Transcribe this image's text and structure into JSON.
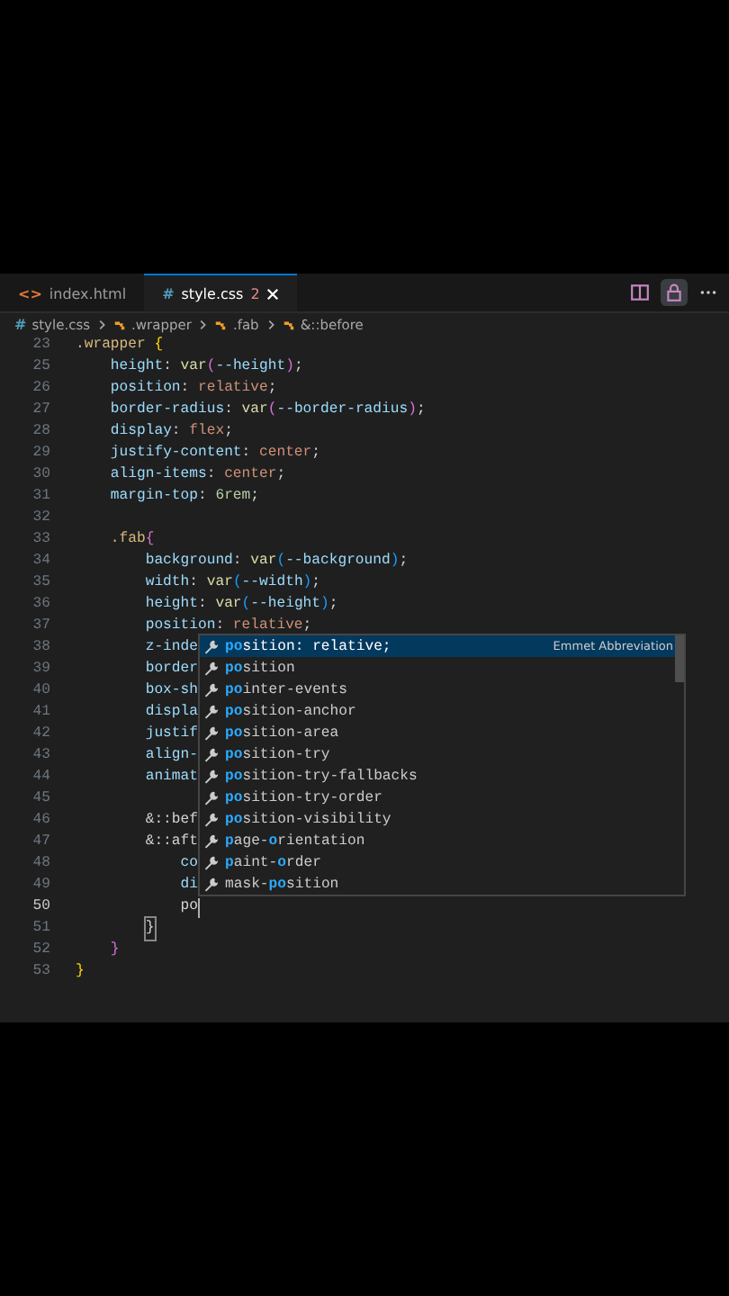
{
  "tabs": [
    {
      "label": "index.html",
      "icon": "<>",
      "kind": "html",
      "selected": false
    },
    {
      "label": "style.css",
      "icon": "#",
      "badge": "2",
      "kind": "css",
      "selected": true
    }
  ],
  "breadcrumb": [
    {
      "text": "style.css",
      "icon": "#",
      "kind": "file"
    },
    {
      "text": ".wrapper",
      "kind": "symbol"
    },
    {
      "text": ".fab",
      "kind": "symbol"
    },
    {
      "text": "&::before",
      "kind": "symbol"
    }
  ],
  "code_lines": [
    {
      "number": "23",
      "active": false,
      "segments": [
        {
          "text": ".wrapper ",
          "kind": "selector"
        },
        {
          "text": "{",
          "kind": "bracket1"
        }
      ],
      "children": [
        {
          "number": "25",
          "active": false,
          "segments": [
            {
              "text": "height",
              "kind": "property"
            },
            {
              "text": ": ",
              "kind": "plain"
            },
            {
              "text": "var",
              "kind": "function"
            },
            {
              "text": "(",
              "kind": "bracket2"
            },
            {
              "text": "--height",
              "kind": "property"
            },
            {
              "text": ")",
              "kind": "bracket2"
            },
            {
              "text": ";",
              "kind": "plain"
            }
          ]
        },
        {
          "number": "26",
          "active": false,
          "segments": [
            {
              "text": "position",
              "kind": "property"
            },
            {
              "text": ": ",
              "kind": "plain"
            },
            {
              "text": "relative",
              "kind": "value"
            },
            {
              "text": ";",
              "kind": "plain"
            }
          ]
        },
        {
          "number": "27",
          "active": false,
          "segments": [
            {
              "text": "border-radius",
              "kind": "property"
            },
            {
              "text": ": ",
              "kind": "plain"
            },
            {
              "text": "var",
              "kind": "function"
            },
            {
              "text": "(",
              "kind": "bracket2"
            },
            {
              "text": "--border-radius",
              "kind": "property"
            },
            {
              "text": ")",
              "kind": "bracket2"
            },
            {
              "text": ";",
              "kind": "plain"
            }
          ]
        },
        {
          "number": "28",
          "active": false,
          "segments": [
            {
              "text": "display",
              "kind": "property"
            },
            {
              "text": ": ",
              "kind": "plain"
            },
            {
              "text": "flex",
              "kind": "value"
            },
            {
              "text": ";",
              "kind": "plain"
            }
          ]
        },
        {
          "number": "29",
          "active": false,
          "segments": [
            {
              "text": "justify-content",
              "kind": "property"
            },
            {
              "text": ": ",
              "kind": "plain"
            },
            {
              "text": "center",
              "kind": "value"
            },
            {
              "text": ";",
              "kind": "plain"
            }
          ]
        },
        {
          "number": "30",
          "active": false,
          "segments": [
            {
              "text": "align-items",
              "kind": "property"
            },
            {
              "text": ": ",
              "kind": "plain"
            },
            {
              "text": "center",
              "kind": "value"
            },
            {
              "text": ";",
              "kind": "plain"
            }
          ]
        },
        {
          "number": "31",
          "active": false,
          "segments": [
            {
              "text": "margin-top",
              "kind": "property"
            },
            {
              "text": ": ",
              "kind": "plain"
            },
            {
              "text": "6rem",
              "kind": "number"
            },
            {
              "text": ";",
              "kind": "plain"
            }
          ]
        },
        {
          "number": "32",
          "active": false
        },
        {
          "number": "33",
          "active": false,
          "segments": [
            {
              "text": ".fab",
              "kind": "selector"
            },
            {
              "text": "{",
              "kind": "bracket2"
            }
          ],
          "children": [
            {
              "number": "34",
              "active": false,
              "segments": [
                {
                  "text": "background",
                  "kind": "property"
                },
                {
                  "text": ": ",
                  "kind": "plain"
                },
                {
                  "text": "var",
                  "kind": "function"
                },
                {
                  "text": "(",
                  "kind": "bracket3"
                },
                {
                  "text": "--background",
                  "kind": "property"
                },
                {
                  "text": ")",
                  "kind": "bracket3"
                },
                {
                  "text": ";",
                  "kind": "plain"
                }
              ]
            },
            {
              "number": "35",
              "active": false,
              "segments": [
                {
                  "text": "width",
                  "kind": "property"
                },
                {
                  "text": ": ",
                  "kind": "plain"
                },
                {
                  "text": "var",
                  "kind": "function"
                },
                {
                  "text": "(",
                  "kind": "bracket3"
                },
                {
                  "text": "--width",
                  "kind": "property"
                },
                {
                  "text": ")",
                  "kind": "bracket3"
                },
                {
                  "text": ";",
                  "kind": "plain"
                }
              ]
            },
            {
              "number": "36",
              "active": false,
              "segments": [
                {
                  "text": "height",
                  "kind": "property"
                },
                {
                  "text": ": ",
                  "kind": "plain"
                },
                {
                  "text": "var",
                  "kind": "function"
                },
                {
                  "text": "(",
                  "kind": "bracket3"
                },
                {
                  "text": "--height",
                  "kind": "property"
                },
                {
                  "text": ")",
                  "kind": "bracket3"
                },
                {
                  "text": ";",
                  "kind": "plain"
                }
              ]
            },
            {
              "number": "37",
              "active": false,
              "segments": [
                {
                  "text": "position",
                  "kind": "property"
                },
                {
                  "text": ": ",
                  "kind": "plain"
                },
                {
                  "text": "relative",
                  "kind": "value"
                },
                {
                  "text": ";",
                  "kind": "plain"
                }
              ]
            },
            {
              "number": "38",
              "active": false,
              "segments": [
                {
                  "text": "z-inde",
                  "kind": "property"
                }
              ]
            },
            {
              "number": "39",
              "active": false,
              "segments": [
                {
                  "text": "border",
                  "kind": "property"
                }
              ]
            },
            {
              "number": "40",
              "active": false,
              "segments": [
                {
                  "text": "box-sh",
                  "kind": "property"
                }
              ]
            },
            {
              "number": "41",
              "active": false,
              "segments": [
                {
                  "text": "displa",
                  "kind": "property"
                }
              ]
            },
            {
              "number": "42",
              "active": false,
              "segments": [
                {
                  "text": "justif",
                  "kind": "property"
                }
              ]
            },
            {
              "number": "43",
              "active": false,
              "segments": [
                {
                  "text": "align-",
                  "kind": "property"
                }
              ]
            },
            {
              "number": "44",
              "active": false,
              "segments": [
                {
                  "text": "animat",
                  "kind": "property"
                }
              ]
            },
            {
              "number": "45",
              "active": false
            },
            {
              "number": "46",
              "active": false,
              "segments": [
                {
                  "text": "&::bef",
                  "kind": "plain"
                }
              ]
            },
            {
              "number": "47",
              "active": false,
              "segments": [
                {
                  "text": "&::aft",
                  "kind": "plain"
                }
              ],
              "children": [
                {
                  "number": "48",
                  "active": false,
                  "segments": [
                    {
                      "text": "co",
                      "kind": "property"
                    }
                  ]
                },
                {
                  "number": "49",
                  "active": false,
                  "segments": [
                    {
                      "text": "di",
                      "kind": "property"
                    }
                  ]
                },
                {
                  "number": "50",
                  "active": true,
                  "segments": [
                    {
                      "text": "po",
                      "kind": "plain"
                    }
                  ]
                }
              ]
            },
            {
              "number": "51",
              "active": false,
              "segments": [
                {
                  "text": "}",
                  "kind": "matched"
                }
              ]
            }
          ]
        },
        {
          "number": "52",
          "active": false,
          "segments": [
            {
              "text": "}",
              "kind": "bracket2"
            }
          ]
        }
      ]
    },
    {
      "number": "53",
      "active": false,
      "segments": [
        {
          "text": "}",
          "kind": "bracket1"
        }
      ]
    }
  ],
  "suggestions": [
    {
      "selected": true,
      "label": "**po**sition: relative;",
      "detail": "Emmet Abbreviation"
    },
    {
      "selected": false,
      "label": "**po**sition"
    },
    {
      "selected": false,
      "label": "**po**inter-events"
    },
    {
      "selected": false,
      "label": "**po**sition-anchor"
    },
    {
      "selected": false,
      "label": "**po**sition-area"
    },
    {
      "selected": false,
      "label": "**po**sition-try"
    },
    {
      "selected": false,
      "label": "**po**sition-try-fallbacks"
    },
    {
      "selected": false,
      "label": "**po**sition-try-order"
    },
    {
      "selected": false,
      "label": "**po**sition-visibility"
    },
    {
      "selected": false,
      "label": "**p**age-**o**rientation"
    },
    {
      "selected": false,
      "label": "**p**aint-**o**rder"
    },
    {
      "selected": false,
      "label": "mask-**po**sition"
    }
  ]
}
